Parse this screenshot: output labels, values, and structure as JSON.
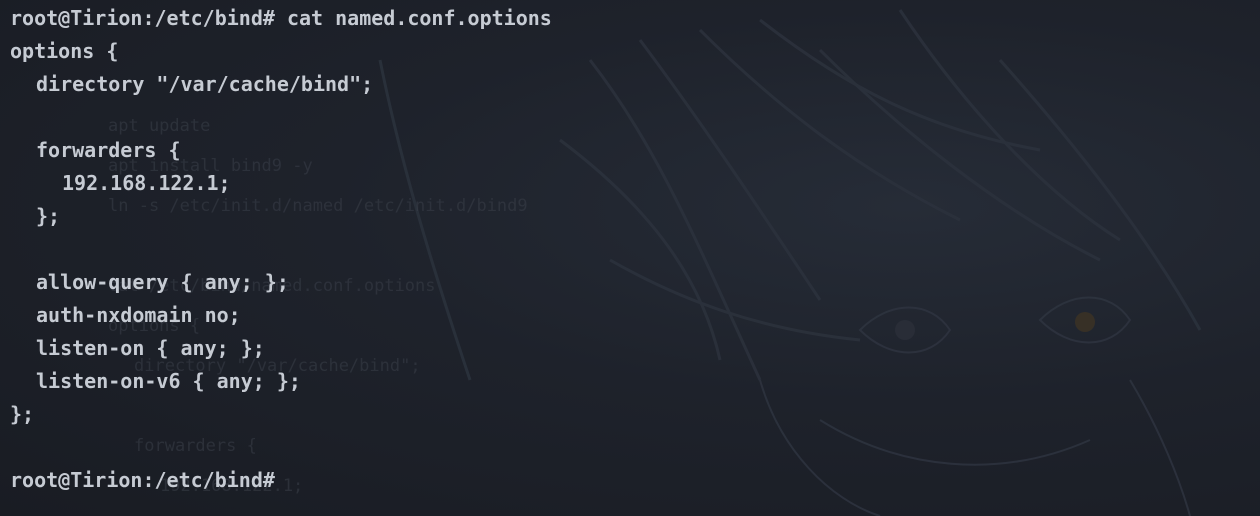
{
  "terminal": {
    "background_color": "#1b1f27",
    "text_color": "#c6cbd3",
    "lines": [
      "root@Tirion:/etc/bind# cat named.conf.options",
      "options {",
      "directory \"/var/cache/bind\";",
      "",
      "forwarders {",
      "192.168.122.1;",
      "};",
      "",
      "allow-query { any; };",
      "auth-nxdomain no;",
      "listen-on { any; };",
      "listen-on-v6 { any; };",
      "};",
      "",
      "root@Tirion:/etc/bind#"
    ],
    "wallpaper_text": [
      "apt update",
      "apt install bind9 -y",
      "ln -s /etc/init.d/named /etc/init.d/bind9",
      "cat /etc/bind/named.conf.options",
      "options {",
      "directory \"/var/cache/bind\";",
      "forwarders {",
      "192.168.122.1;"
    ]
  }
}
